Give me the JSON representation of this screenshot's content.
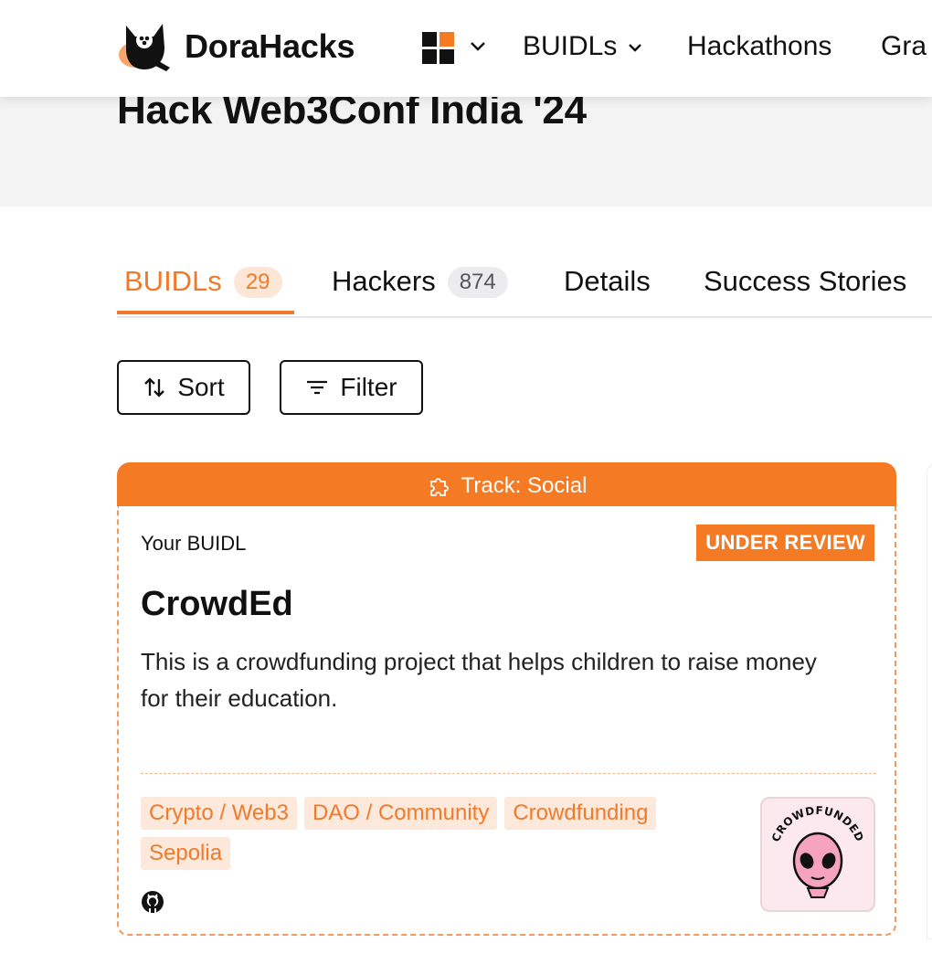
{
  "brand": {
    "name": "DoraHacks"
  },
  "nav": {
    "apps_icon": "grid-apps-icon",
    "items": [
      {
        "label": "BUIDLs",
        "has_dropdown": true
      },
      {
        "label": "Hackathons"
      },
      {
        "label": "Gra"
      }
    ]
  },
  "hackathon": {
    "title": "Hack Web3Conf India '24"
  },
  "tabs": [
    {
      "label": "BUIDLs",
      "count": "29",
      "active": true
    },
    {
      "label": "Hackers",
      "count": "874"
    },
    {
      "label": "Details"
    },
    {
      "label": "Success Stories"
    }
  ],
  "toolbar": {
    "sort_label": "Sort",
    "filter_label": "Filter"
  },
  "card": {
    "track": "Track: Social",
    "owner_label": "Your BUIDL",
    "status": "UNDER REVIEW",
    "title": "CrowdEd",
    "description": "This is a crowdfunding project that helps children to raise money for their education.",
    "tags": [
      "Crypto / Web3",
      "DAO / Community",
      "Crowdfunding",
      "Sepolia"
    ],
    "thumbnail_text": "CROWDFUNDED",
    "github_icon": "github-icon"
  },
  "colors": {
    "accent": "#f47a24",
    "tag_bg": "#fde9dc",
    "thumb_pink": "#f6a3c0"
  }
}
